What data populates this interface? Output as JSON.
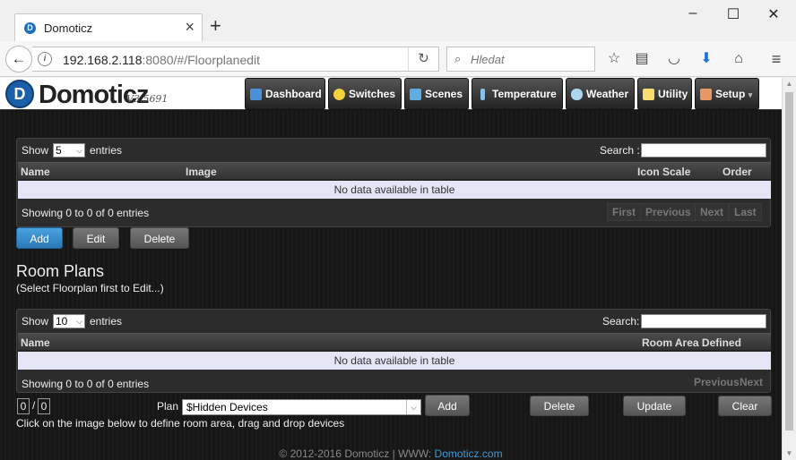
{
  "browser": {
    "tab_title": "Domoticz",
    "tab_close": "×",
    "new_tab": "+",
    "url_host": "192.168.2.118",
    "url_rest": ":8080/#/Floorplanedit",
    "search_placeholder": "Hledat",
    "window_controls": [
      "–",
      "☐",
      "✕"
    ],
    "toolbar_icons": [
      "star-icon",
      "reading-list-icon",
      "pocket-icon",
      "download-icon",
      "home-icon",
      "hamburger-menu-icon"
    ]
  },
  "app": {
    "logo_text": "Domoticz",
    "version": "V3.5691",
    "menu": [
      {
        "label": "Dashboard",
        "icon": "dashboard-icon",
        "color": "#4a90d9"
      },
      {
        "label": "Switches",
        "icon": "bulb-icon",
        "color": "#f4d03f"
      },
      {
        "label": "Scenes",
        "icon": "scenes-icon",
        "color": "#5dade2"
      },
      {
        "label": "Temperature",
        "icon": "thermometer-icon",
        "color": "#85c1e9"
      },
      {
        "label": "Weather",
        "icon": "weather-icon",
        "color": "#aed6f1"
      },
      {
        "label": "Utility",
        "icon": "utility-icon",
        "color": "#f7dc6f"
      },
      {
        "label": "Setup",
        "icon": "setup-icon",
        "color": "#e59866",
        "caret": "▾"
      }
    ],
    "floorplans_table": {
      "show_label": "Show",
      "show_value": "5",
      "entries_label": "entries",
      "search_label": "Search :",
      "columns": [
        "Name",
        "Image",
        "Icon Scale",
        "Order"
      ],
      "empty_text": "No data available in table",
      "info_text": "Showing 0 to 0 of 0 entries",
      "pager": [
        "First",
        "Previous",
        "Next",
        "Last"
      ]
    },
    "floorplan_buttons": {
      "add": "Add",
      "edit": "Edit",
      "delete": "Delete"
    },
    "room_plans": {
      "title": "Room Plans",
      "subtitle": "(Select Floorplan first to Edit...)"
    },
    "rooms_table": {
      "show_label": "Show",
      "show_value": "10",
      "entries_label": "entries",
      "search_label": "Search:",
      "columns": [
        "Name",
        "Room Area Defined"
      ],
      "empty_text": "No data available in table",
      "info_text": "Showing 0 to 0 of 0 entries",
      "pager": [
        "Previous",
        "Next"
      ]
    },
    "plan_controls": {
      "counter_left": "0",
      "counter_sep": "/",
      "counter_right": "0",
      "plan_label": "Plan",
      "plan_selected": "$Hidden Devices",
      "add": "Add",
      "delete": "Delete",
      "update": "Update",
      "clear": "Clear",
      "hint": "Click on the image below to define room area, drag and drop devices"
    },
    "footer": {
      "text": "© 2012-2016 Domoticz | WWW: ",
      "link": "Domoticz.com"
    }
  }
}
